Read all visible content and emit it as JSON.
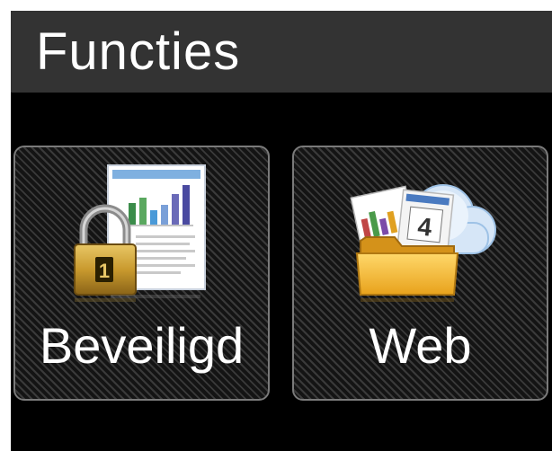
{
  "header": {
    "title": "Functies"
  },
  "tiles": [
    {
      "label": "Beveiligd",
      "icon": "secure-print-icon"
    },
    {
      "label": "Web",
      "icon": "web-folder-icon"
    }
  ],
  "colors": {
    "screen_bg": "#000000",
    "header_bg": "#333333",
    "text": "#ffffff",
    "tile_border": "#7a7a7a"
  }
}
